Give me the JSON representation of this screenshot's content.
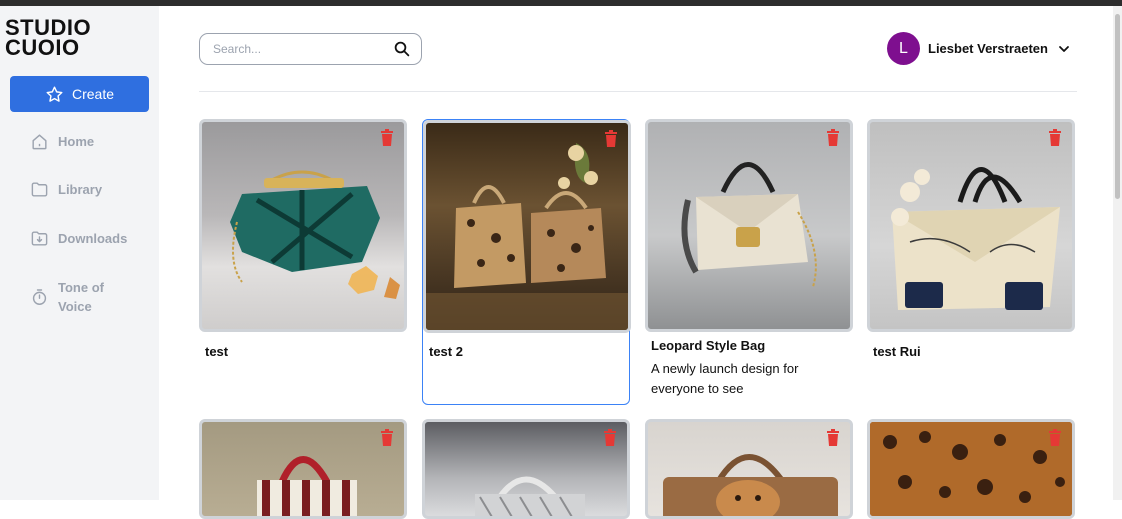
{
  "brand": {
    "line1": "STUDIO",
    "line2": "CUOIO"
  },
  "sidebar": {
    "create_label": "Create",
    "items": [
      {
        "label": "Home",
        "icon": "home-icon"
      },
      {
        "label": "Library",
        "icon": "folder-icon"
      },
      {
        "label": "Downloads",
        "icon": "download-icon"
      },
      {
        "label": "Tone of Voice",
        "icon": "timer-icon"
      }
    ]
  },
  "search": {
    "placeholder": "Search...",
    "value": ""
  },
  "user": {
    "initial": "L",
    "name": "Liesbet Verstraeten",
    "avatar_color": "#7e0f8f"
  },
  "colors": {
    "accent": "#2f6fe0",
    "delete": "#e53935",
    "selected_border": "#3b82f6"
  },
  "cards": [
    {
      "title": "test",
      "description": "",
      "image": "teal quilted clutch bag",
      "selected": false
    },
    {
      "title": "test 2",
      "description": "",
      "image": "two leopard print handbags with flowers",
      "selected": true
    },
    {
      "title": "Leopard Style Bag",
      "description": "A newly launch design for everyone to see",
      "image": "cream leather handbag with gold clasp",
      "selected": false
    },
    {
      "title": "test Rui",
      "description": "",
      "image": "cream tote bag with magnolia flowers",
      "selected": false
    },
    {
      "title": "",
      "description": "",
      "image": "striped handbag with red handle",
      "selected": false
    },
    {
      "title": "",
      "description": "",
      "image": "silver metallic handbag",
      "selected": false
    },
    {
      "title": "",
      "description": "",
      "image": "brown leather bag with dog",
      "selected": false
    },
    {
      "title": "",
      "description": "",
      "image": "leopard print leather bag",
      "selected": false
    }
  ]
}
